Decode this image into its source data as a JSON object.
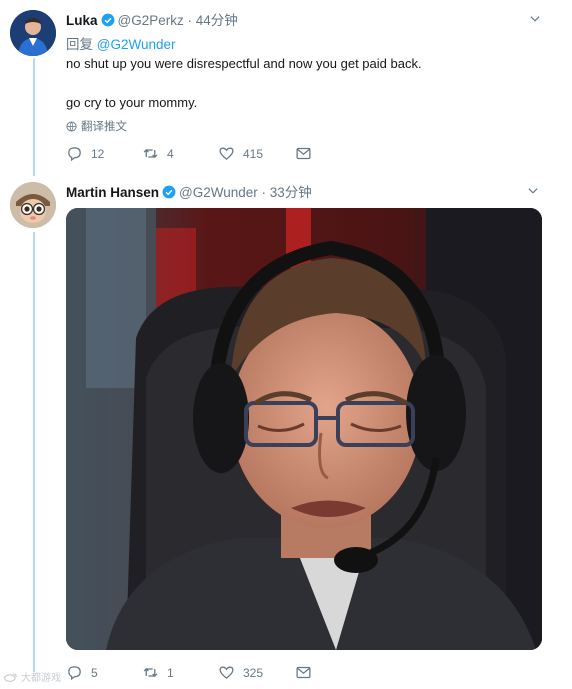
{
  "tweet1": {
    "display_name": "Luka",
    "handle": "@G2Perkz",
    "time": "· 44分钟",
    "reply_prefix": "回复",
    "reply_target": "@G2Wunder",
    "line1": "no shut up you were disrespectful and now you get paid back.",
    "line2": "go cry to your mommy.",
    "translate_label": "翻译推文",
    "replies": "12",
    "retweets": "4",
    "likes": "415"
  },
  "tweet2": {
    "display_name": "Martin Hansen",
    "handle": "@G2Wunder",
    "time": "· 33分钟",
    "replies": "5",
    "retweets": "1",
    "likes": "325"
  },
  "watermark": {
    "text": "大都游戏"
  },
  "colors": {
    "accent": "#1da1f2",
    "muted": "#657786",
    "thread_line": "#b3dbf5"
  }
}
